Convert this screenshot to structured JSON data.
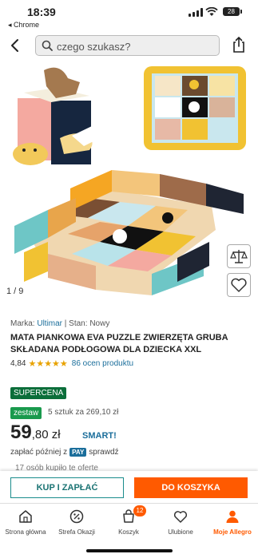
{
  "status": {
    "time": "18:39",
    "back_app": "◂ Chrome",
    "battery": "28"
  },
  "search": {
    "placeholder": "czego szukasz?"
  },
  "gallery": {
    "counter": "1 / 9"
  },
  "product": {
    "brand_label": "Marka:",
    "brand": "Ultimar",
    "condition_label": "| Stan:",
    "condition": "Nowy",
    "title": "MATA PIANKOWA EVA PUZZLE ZWIERZĘTA GRUBA SKŁADANA PODŁOGOWA DLA DZIECKA XXL",
    "rating": "4,84",
    "stars": "★★★★★",
    "reviews": "86 ocen produktu",
    "badge_super": "SUPERCENA",
    "badge_set": "zestaw",
    "set_text": "5 sztuk za 269,10 zł",
    "price_main": "59",
    "price_rest": ",80 zł",
    "smart": "SMART!",
    "pay_later_prefix": "zapłać później z",
    "pay_badge": "PAY",
    "pay_later_suffix": "sprawdź",
    "bought": "17 osób kupiło te oferte"
  },
  "actions": {
    "buy_now": "KUP I ZAPŁAĆ",
    "add_to_cart": "DO KOSZYKA"
  },
  "tabbar": {
    "items": [
      {
        "label": "Strona główna"
      },
      {
        "label": "Strefa Okazji"
      },
      {
        "label": "Koszyk",
        "badge": "12"
      },
      {
        "label": "Ulubione"
      },
      {
        "label": "Moje Allegro"
      }
    ]
  },
  "colors": {
    "accent": "#ff5a00",
    "teal": "#1a7373",
    "link": "#1b6e9b",
    "green": "#0b6e3a"
  }
}
